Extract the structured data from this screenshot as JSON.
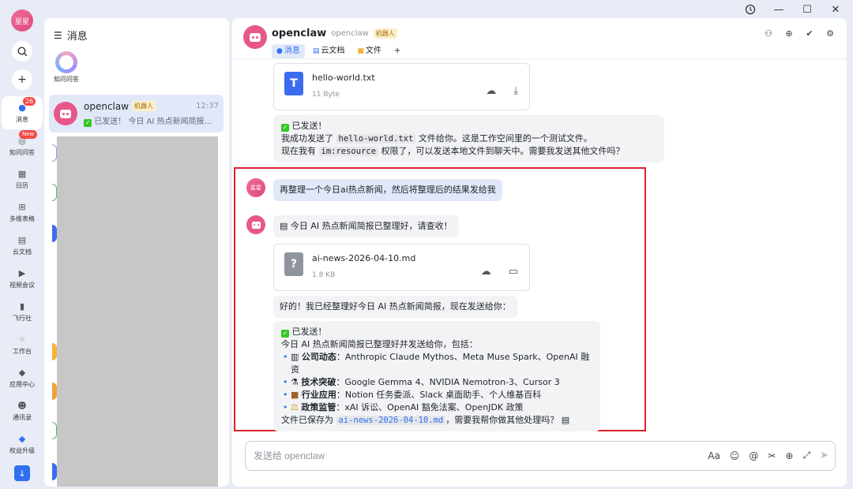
{
  "window": {
    "history_icon": "history-icon",
    "min": "—",
    "max": "☐",
    "close": "✕"
  },
  "rail": {
    "me_avatar": "星星",
    "items": [
      {
        "label": "消息",
        "badge": "26"
      },
      {
        "label": "知问问答",
        "badge": "New"
      },
      {
        "label": "日历"
      },
      {
        "label": "多维表格"
      },
      {
        "label": "云文档"
      },
      {
        "label": "视频会议"
      },
      {
        "label": "飞行社"
      },
      {
        "label": "工作台"
      },
      {
        "label": "应用中心"
      },
      {
        "label": "通讯录"
      },
      {
        "label": "权益升级"
      }
    ]
  },
  "list": {
    "header": "消息",
    "zhiwen_label": "知问问答",
    "conversation": {
      "name": "openclaw",
      "tag": "机器人",
      "time": "12:37",
      "preview": "已发送！ 今日 AI 热点新闻简报..."
    }
  },
  "chat": {
    "title": "openclaw",
    "subtitle": "openclaw",
    "tag": "机器人",
    "tabs": [
      {
        "label": "消息"
      },
      {
        "label": "云文档"
      },
      {
        "label": "文件"
      }
    ],
    "add_tab": "+",
    "file1": {
      "name": "hello-world.txt",
      "size": "11 Byte"
    },
    "msg1": {
      "status": "已发送！",
      "line1_a": "我成功发送了",
      "line1_code": "hello-world.txt",
      "line1_b": "文件给你。这是工作空间里的一个测试文件。",
      "line2_a": "现在我有",
      "line2_code": "im:resource",
      "line2_b": "权限了，可以发送本地文件到聊天中。需要我发送其他文件吗？"
    },
    "me_avatar": "星星",
    "user_msg": "再整理一个今日ai热点新闻，然后将整理后的结果发给我",
    "bot_msg1": "今日 AI 热点新闻简报已整理好，请查收！",
    "file2": {
      "name": "ai-news-2026-04-10.md",
      "size": "1.8 KB"
    },
    "bot_msg2": "好的！我已经整理好今日 AI 热点新闻简报，现在发送给你：",
    "msg3": {
      "status": "已发送！",
      "intro": "今日 AI 热点新闻简报已整理好并发送给你，包括：",
      "bullets": [
        {
          "key": "公司动态",
          "text": "：Anthropic Claude Mythos、Meta Muse Spark、OpenAI 融资"
        },
        {
          "key": "技术突破",
          "text": "：Google Gemma 4、NVIDIA Nemotron-3、Cursor 3"
        },
        {
          "key": "行业应用",
          "text": "：Notion 任务委派、Slack 桌面助手、个人维基百科"
        },
        {
          "key": "政策监管",
          "text": "：xAI 诉讼、OpenAI 豁免法案、OpenJDK 政策"
        }
      ],
      "footer_a": "文件已保存为",
      "footer_code": "ai-news-2026-04-10.md",
      "footer_b": "，需要我帮你做其他处理吗？"
    },
    "input_placeholder": "发送给 openclaw"
  },
  "colors": {
    "accent": "#2f6ff2",
    "highlight_box": "#d9232e",
    "badge": "#f54a45",
    "bot_avatar": "#e8578a"
  }
}
